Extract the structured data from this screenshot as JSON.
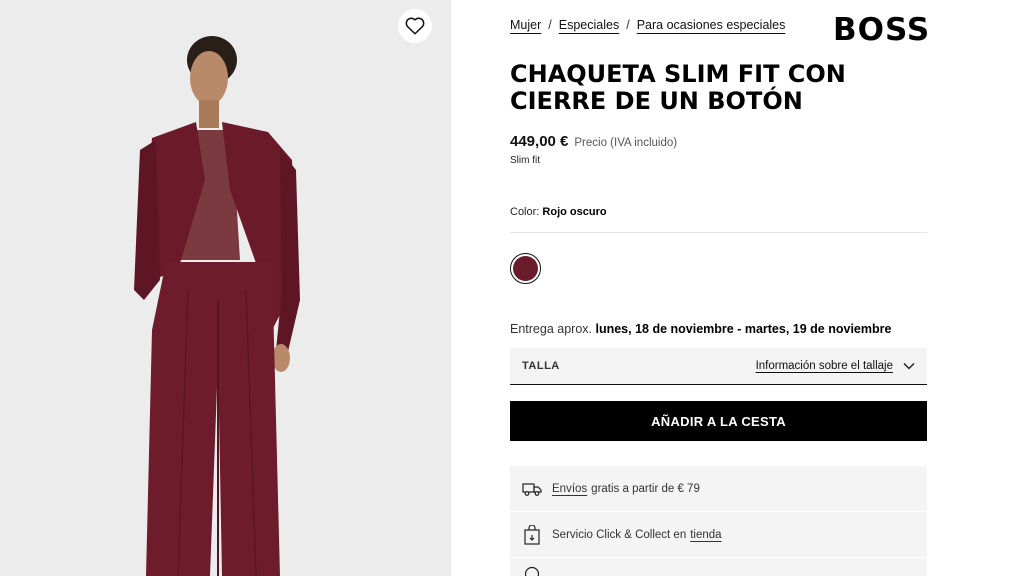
{
  "breadcrumb": [
    {
      "label": "Mujer"
    },
    {
      "label": "Especiales"
    },
    {
      "label": "Para ocasiones especiales"
    }
  ],
  "brand": {
    "logo_text": "BOSS"
  },
  "favorite": {
    "icon": "heart-icon"
  },
  "product": {
    "title": "CHAQUETA SLIM FIT CON CIERRE DE UN BOTÓN",
    "price": "449,00 €",
    "price_note": "Precio (IVA incluido)",
    "fit": "Slim fit",
    "color_label": "Color:",
    "color_value": "Rojo oscuro",
    "swatch_color": "#6b1a2a"
  },
  "delivery": {
    "label": "Entrega aprox.",
    "dates": "lunes, 18 de noviembre - martes, 19 de noviembre"
  },
  "size": {
    "label": "TALLA",
    "guide_link": "Información sobre el tallaje"
  },
  "cart": {
    "add_label": "AÑADIR A LA CESTA"
  },
  "services": {
    "shipping_link": "Envíos",
    "shipping_text": "gratis a partir de € 79",
    "collect_text": "Servicio Click & Collect en",
    "collect_link": "tienda"
  },
  "colors": {
    "background_image": "#ececec",
    "suit": "#6b1a2a",
    "button": "#000000"
  }
}
